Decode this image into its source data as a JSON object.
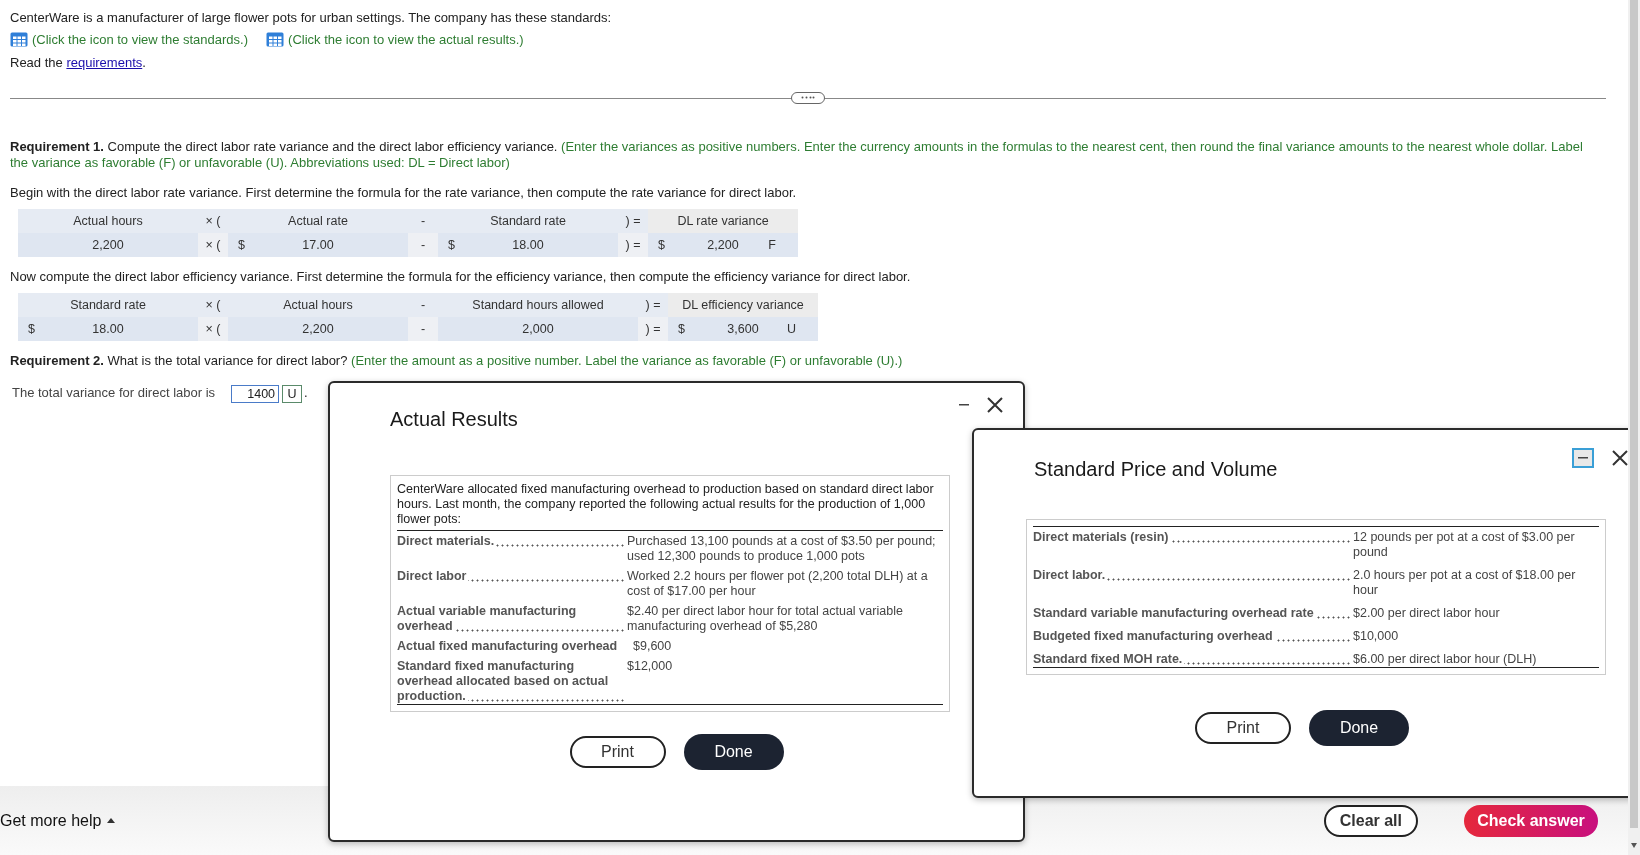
{
  "intro": {
    "text": "CenterWare is a manufacturer of large flower pots for urban settings. The company has these standards:",
    "links": [
      {
        "label": "(Click the icon to view the standards.)"
      },
      {
        "label": "(Click the icon to view the actual results.)"
      }
    ],
    "read_prefix": "Read the ",
    "read_link": "requirements",
    "read_suffix": "."
  },
  "requirement_1": {
    "text": "**Requirement 1.** Compute the direct labor rate variance and the direct labor efficiency variance.",
    "instructions": "(Enter the variances as positive numbers. Enter the currency amounts in the formulas to the nearest cent, then round the final variance amounts to the nearest whole dollar. Label the variance as favorable (F) or unfavorable (U). Abbreviations used: DL = Direct labor)"
  },
  "formulas": [
    {
      "lead": "Begin with the direct labor rate variance. First determine the formula for the rate variance, then compute the rate variance for direct labor.",
      "items": [
        {
          "kind": "term",
          "header": "Actual hours",
          "value": "2,200"
        },
        {
          "kind": "op",
          "header": "× (",
          "value": "× ("
        },
        {
          "kind": "term",
          "header": "Actual rate",
          "prefix": "$",
          "value": "17.00"
        },
        {
          "kind": "op",
          "header": "-",
          "value": "-"
        },
        {
          "kind": "term",
          "header": "Standard rate",
          "prefix": "$",
          "value": "18.00"
        },
        {
          "kind": "op",
          "header": ") =",
          "value": ") ="
        },
        {
          "kind": "result",
          "header": "DL rate variance",
          "prefix": "$",
          "value": "2,200",
          "label": "F"
        }
      ]
    },
    {
      "lead": "Now compute the direct labor efficiency variance. First determine the formula for the efficiency variance, then compute the efficiency variance for direct labor.",
      "items": [
        {
          "kind": "term",
          "header": "Standard rate",
          "prefix": "$",
          "value": "18.00"
        },
        {
          "kind": "op",
          "header": "× (",
          "value": "× ("
        },
        {
          "kind": "term",
          "header": "Actual hours",
          "value": "2,200"
        },
        {
          "kind": "op",
          "header": "-",
          "value": "-"
        },
        {
          "kind": "term",
          "header": "Standard hours allowed",
          "value": "2,000"
        },
        {
          "kind": "op",
          "header": ") =",
          "value": ") ="
        },
        {
          "kind": "result",
          "header": "DL efficiency variance",
          "prefix": "$",
          "value": "3,600",
          "label": "U"
        }
      ]
    }
  ],
  "requirement_2": {
    "text": "**Requirement 2.** What is the total variance for direct labor?",
    "instructions": "(Enter the amount as a positive number. Label the variance as favorable (F) or unfavorable (U).)",
    "answer_label": "The total variance for direct labor is",
    "amount": "1400",
    "variance_label": "U",
    "end": "."
  },
  "footer": {
    "help": "Get more help",
    "clear": "Clear all",
    "check": "Check answer"
  },
  "actual_results": {
    "title": "Actual Results",
    "intro": "CenterWare allocated fixed manufacturing overhead to production based on standard direct labor hours. Last month, the company reported the following actual results for the production of 1,000 flower pots:",
    "rows": [
      {
        "label": "Direct materials.",
        "value": "Purchased 13,100 pounds at a cost of $3.50 per pound; used 12,300 pounds to produce 1,000 pots",
        "leader": true
      },
      {
        "label": "Direct labor",
        "value": "Worked 2.2 hours per flower pot (2,200 total DLH) at a cost of $17.00 per hour",
        "leader": true
      },
      {
        "label": "Actual variable manufacturing overhead",
        "value": "$2.40 per direct labor hour for total actual variable manufacturing overhead of $5,280",
        "leader": true
      },
      {
        "label": "Actual fixed manufacturing overhead",
        "value": "$9,600",
        "leader": false
      },
      {
        "label": "Standard fixed manufacturing overhead allocated based on actual production.",
        "value": "$12,000",
        "leader": true
      }
    ],
    "buttons": {
      "print": "Print",
      "done": "Done"
    }
  },
  "standard": {
    "title": "Standard Price and Volume",
    "rows": [
      {
        "label": "Direct materials (resin)",
        "value": "12 pounds per pot at a cost of $3.00 per pound",
        "leader": true
      },
      {
        "label": "Direct labor.",
        "value": "2.0 hours per pot at a cost of $18.00 per hour",
        "leader": true
      },
      {
        "label": "Standard variable manufacturing overhead rate",
        "value": "$2.00 per direct labor hour",
        "leader": true
      },
      {
        "label": "Budgeted fixed manufacturing overhead",
        "value": "$10,000",
        "leader": true
      },
      {
        "label": "Standard fixed MOH rate.",
        "value": "$6.00 per direct labor hour (DLH)",
        "leader": true
      }
    ],
    "buttons": {
      "print": "Print",
      "done": "Done"
    }
  }
}
